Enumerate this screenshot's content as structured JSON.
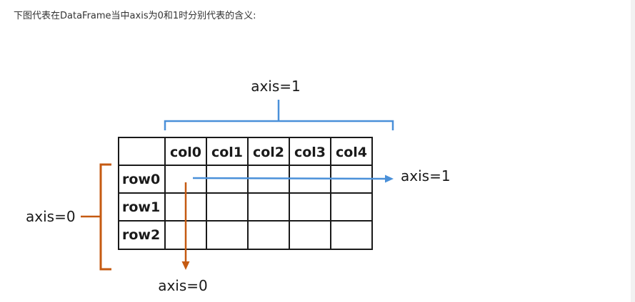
{
  "caption": "下图代表在DataFrame当中axis为0和1时分别代表的含义:",
  "diagram": {
    "column_headers": [
      "col0",
      "col1",
      "col2",
      "col3",
      "col4"
    ],
    "row_labels": [
      "row0",
      "row1",
      "row2"
    ],
    "top_brace_label": "axis=1",
    "right_arrow_label": "axis=1",
    "left_brace_label": "axis=0",
    "down_arrow_label": "axis=0",
    "colors": {
      "axis1": "#4a90d9",
      "axis0": "#c55a11",
      "grid": "#1a1a1a"
    }
  }
}
